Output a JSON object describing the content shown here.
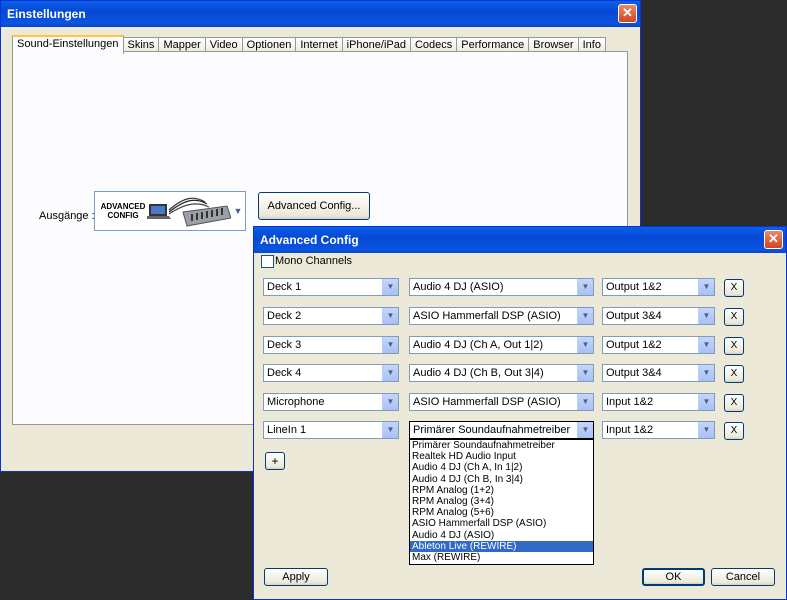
{
  "main_window": {
    "title": "Einstellungen",
    "tabs": [
      {
        "label": "Sound-Einstellungen",
        "active": true
      },
      {
        "label": "Skins"
      },
      {
        "label": "Mapper"
      },
      {
        "label": "Video"
      },
      {
        "label": "Optionen"
      },
      {
        "label": "Internet"
      },
      {
        "label": "iPhone/iPad"
      },
      {
        "label": "Codecs"
      },
      {
        "label": "Performance"
      },
      {
        "label": "Browser"
      },
      {
        "label": "Info"
      }
    ],
    "outputs_label": "Ausgänge :",
    "output_image_text_line1": "ADVANCED",
    "output_image_text_line2": "CONFIG",
    "advanced_config_button": "Advanced Config..."
  },
  "dialog": {
    "title": "Advanced Config",
    "mono_channels_label": "Mono Channels",
    "rows": [
      {
        "source": "Deck 1",
        "device": "Audio 4 DJ (ASIO)",
        "channel": "Output 1&2"
      },
      {
        "source": "Deck 2",
        "device": "ASIO Hammerfall DSP (ASIO)",
        "channel": "Output 3&4"
      },
      {
        "source": "Deck 3",
        "device": "Audio 4 DJ (Ch A, Out 1|2)",
        "channel": "Output 1&2"
      },
      {
        "source": "Deck 4",
        "device": "Audio 4 DJ (Ch B, Out 3|4)",
        "channel": "Output 3&4"
      },
      {
        "source": "Microphone",
        "device": "ASIO Hammerfall DSP (ASIO)",
        "channel": "Input 1&2"
      },
      {
        "source": "LineIn 1",
        "device": "Primärer Soundaufnahmetreiber",
        "channel": "Input 1&2"
      }
    ],
    "remove_label": "X",
    "add_label": "+",
    "device_options": [
      "Primärer Soundaufnahmetreiber",
      "Realtek HD Audio Input",
      "Audio 4 DJ (Ch A, In 1|2)",
      "Audio 4 DJ (Ch B, In 3|4)",
      "RPM Analog (1+2)",
      "RPM Analog (3+4)",
      "RPM Analog (5+6)",
      "ASIO Hammerfall DSP (ASIO)",
      "Audio 4 DJ (ASIO)",
      "Ableton Live (REWIRE)",
      "Max (REWIRE)"
    ],
    "highlighted_option": "Ableton Live (REWIRE)",
    "apply_label": "Apply",
    "ok_label": "OK",
    "cancel_label": "Cancel"
  },
  "colors": {
    "titlebar": "#0648d4",
    "close": "#d0451f",
    "highlight": "#316ac5",
    "face": "#ece9d8"
  }
}
